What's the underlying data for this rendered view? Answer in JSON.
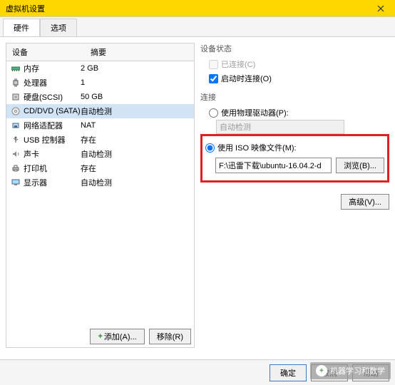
{
  "window": {
    "title": "虚拟机设置"
  },
  "tabs": {
    "hardware": "硬件",
    "options": "选项"
  },
  "hw_header": {
    "device": "设备",
    "summary": "摘要"
  },
  "hardware": [
    {
      "name": "内存",
      "summary": "2 GB",
      "icon": "memory"
    },
    {
      "name": "处理器",
      "summary": "1",
      "icon": "cpu"
    },
    {
      "name": "硬盘(SCSI)",
      "summary": "50 GB",
      "icon": "disk"
    },
    {
      "name": "CD/DVD (SATA)",
      "summary": "自动检测",
      "icon": "cd",
      "selected": true
    },
    {
      "name": "网络适配器",
      "summary": "NAT",
      "icon": "nic"
    },
    {
      "name": "USB 控制器",
      "summary": "存在",
      "icon": "usb"
    },
    {
      "name": "声卡",
      "summary": "自动检测",
      "icon": "sound"
    },
    {
      "name": "打印机",
      "summary": "存在",
      "icon": "printer"
    },
    {
      "name": "显示器",
      "summary": "自动检测",
      "icon": "display"
    }
  ],
  "left_buttons": {
    "add": "添加(A)...",
    "remove": "移除(R)"
  },
  "status": {
    "title": "设备状态",
    "connected": "已连接(C)",
    "connect_on_power": "启动时连接(O)"
  },
  "connection": {
    "title": "连接",
    "use_physical": "使用物理驱动器(P):",
    "auto_detect": "自动检测",
    "use_iso": "使用 ISO 映像文件(M):",
    "iso_path": "F:\\迅雷下载\\ubuntu-16.04.2-d",
    "browse": "浏览(B)..."
  },
  "advanced": "高级(V)...",
  "buttons": {
    "ok": "确定",
    "cancel": "取消",
    "help": "帮助"
  },
  "watermark": "机器学习和数学"
}
